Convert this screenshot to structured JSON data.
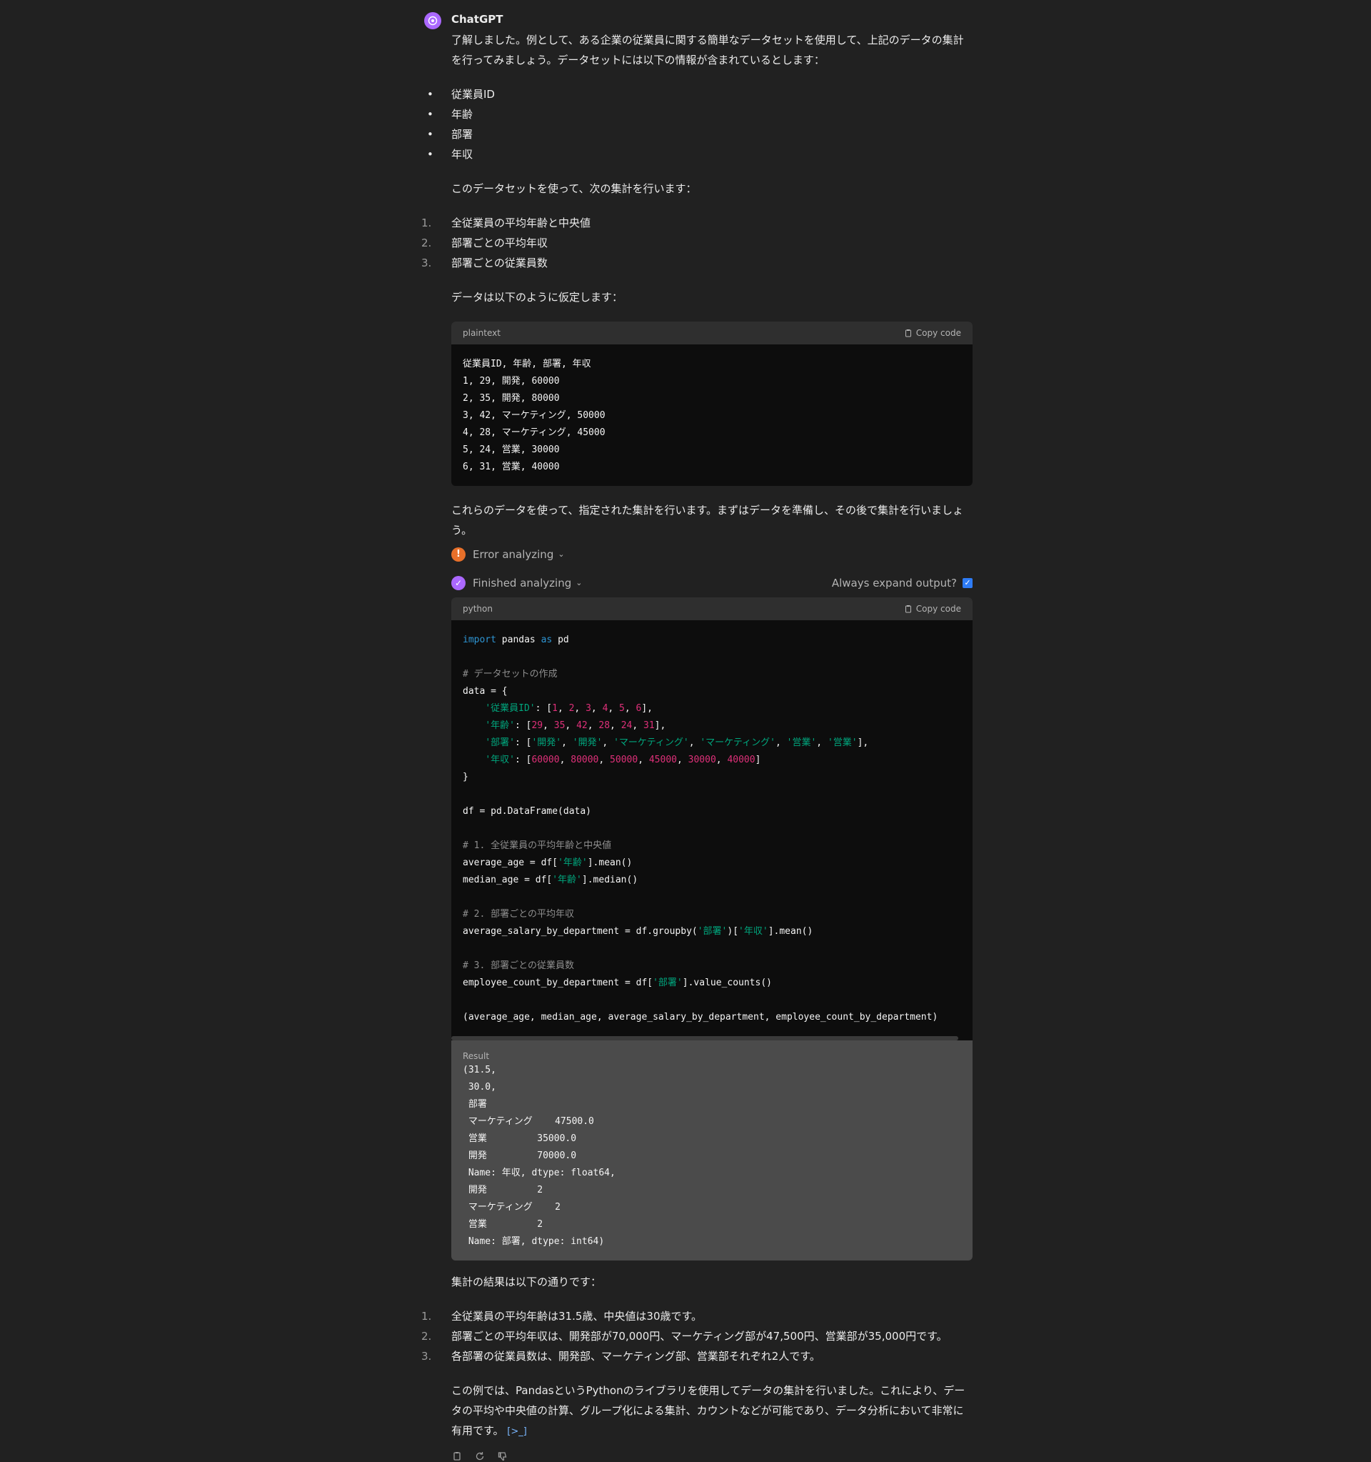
{
  "author": "ChatGPT",
  "intro": "了解しました。例として、ある企業の従業員に関する簡単なデータセットを使用して、上記のデータの集計を行ってみましょう。データセットには以下の情報が含まれているとします：",
  "fields": [
    "従業員ID",
    "年齢",
    "部署",
    "年収"
  ],
  "task_intro": "このデータセットを使って、次の集計を行います：",
  "tasks": [
    "全従業員の平均年齢と中央値",
    "部署ごとの平均年収",
    "部署ごとの従業員数"
  ],
  "data_intro": "データは以下のように仮定します：",
  "plaintext_block": {
    "lang": "plaintext",
    "copy_label": "Copy code",
    "lines": [
      "従業員ID, 年齢, 部署, 年収",
      "1, 29, 開発, 60000",
      "2, 35, 開発, 80000",
      "3, 42, マーケティング, 50000",
      "4, 28, マーケティング, 45000",
      "5, 24, 営業, 30000",
      "6, 31, 営業, 40000"
    ]
  },
  "prepare_text": "これらのデータを使って、指定された集計を行います。まずはデータを準備し、その後で集計を行いましょう。",
  "error_status": "Error analyzing",
  "finished_status": "Finished analyzing",
  "always_expand": "Always expand output?",
  "python_block": {
    "lang": "python",
    "copy_label": "Copy code"
  },
  "result": {
    "label": "Result",
    "lines": [
      "(31.5,",
      " 30.0,",
      " 部署",
      " マーケティング    47500.0",
      " 営業         35000.0",
      " 開発         70000.0",
      " Name: 年収, dtype: float64,",
      " 開発         2",
      " マーケティング    2",
      " 営業         2",
      " Name: 部署, dtype: int64)"
    ]
  },
  "summary_intro": "集計の結果は以下の通りです：",
  "summary": [
    "全従業員の平均年齢は31.5歳、中央値は30歳です。",
    "部署ごとの平均年収は、開発部が70,000円、マーケティング部が47,500円、営業部が35,000円です。",
    "各部署の従業員数は、開発部、マーケティング部、営業部それぞれ2人です。"
  ],
  "conclusion": "この例では、PandasというPythonのライブラリを使用してデータの集計を行いました。これにより、データの平均や中央値の計算、グループ化による集計、カウントなどが可能であり、データ分析において非常に有用です。",
  "citation": "[>_]"
}
